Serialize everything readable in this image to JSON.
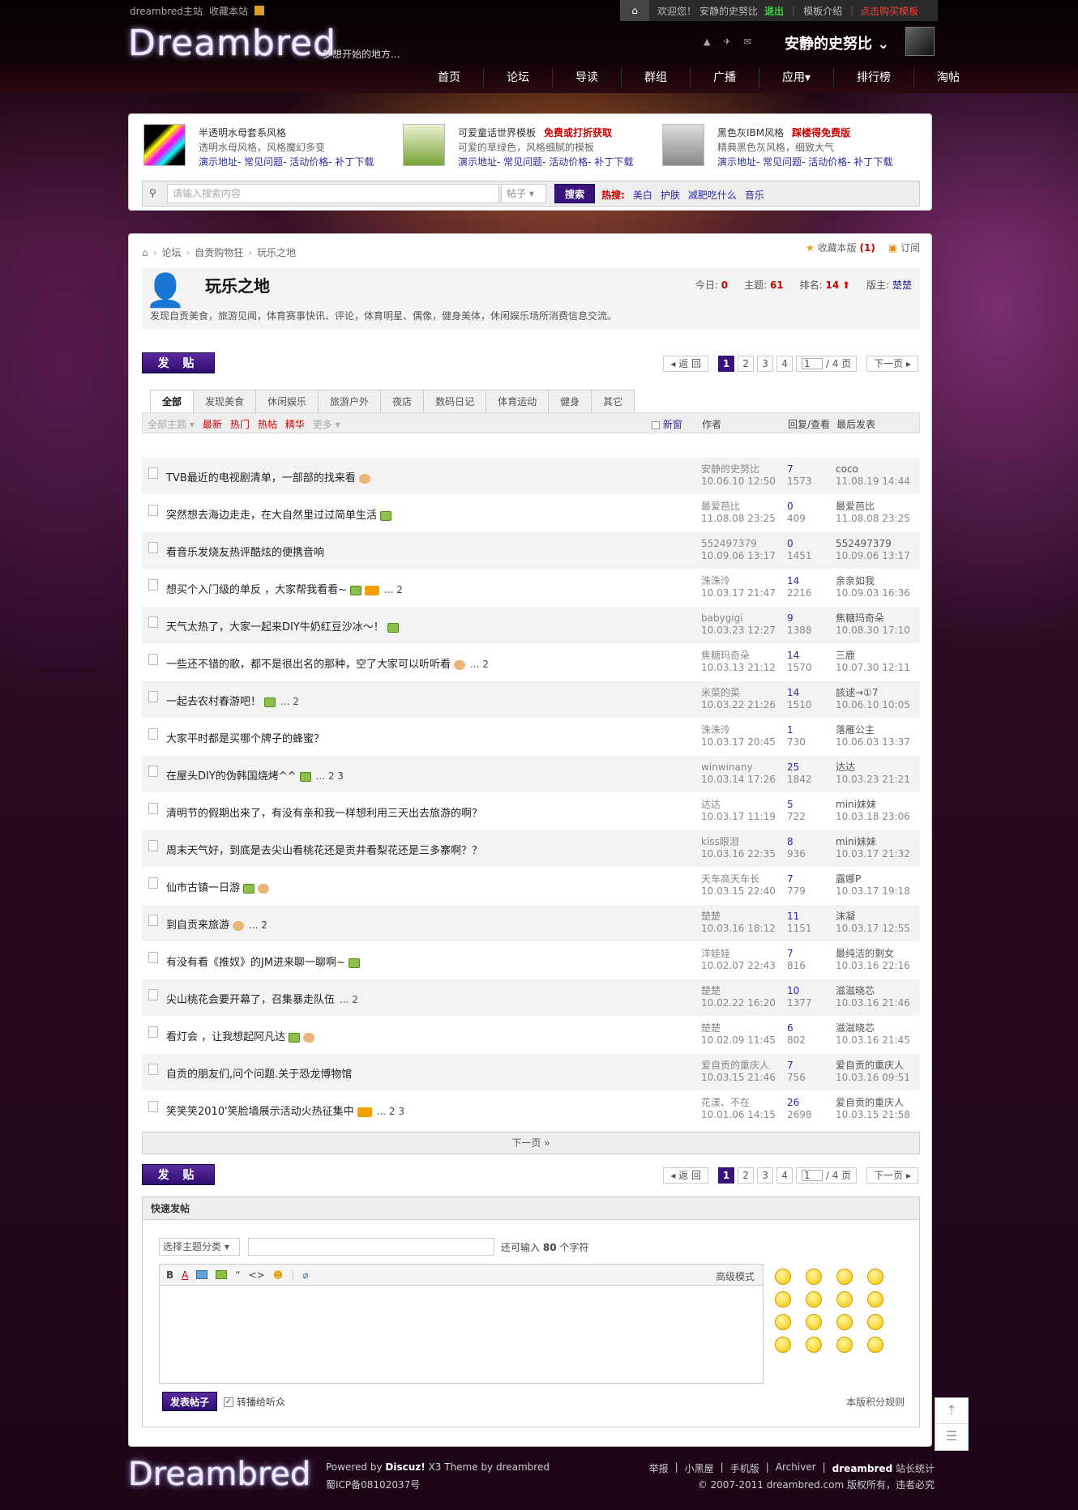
{
  "top": {
    "site_link": "dreambred主站",
    "fav_link": "收藏本站",
    "welcome": "欢迎您！",
    "user": "安静的史努比",
    "logout": "退出",
    "tpl_intro": "模板介绍",
    "buy": "点击购买模板"
  },
  "header": {
    "logo": "Dreambred",
    "slogan": "梦想开始的地方...",
    "username": "安静的史努比"
  },
  "nav": [
    "首页",
    "论坛",
    "导读",
    "群组",
    "广播",
    "应用▾",
    "排行榜",
    "淘帖"
  ],
  "promo": [
    {
      "t1": "半透明水母套系风格",
      "badge": "",
      "t2": "透明水母风格，风格魔幻多变",
      "t3": "演示地址- 常见问题- 活动价格- 补丁下载"
    },
    {
      "t1": "可爱童话世界模板",
      "badge": "免费或打折获取",
      "t2": "可爱的草绿色，风格细腻的模板",
      "t3": "演示地址- 常见问题- 活动价格- 补丁下载"
    },
    {
      "t1": "黑色灰IBM风格",
      "badge": "踩楼得免费版",
      "t2": "精典黑色灰风格，细致大气",
      "t3": "演示地址- 常见问题- 活动价格- 补丁下载"
    }
  ],
  "search": {
    "placeholder": "请输入搜索内容",
    "type": "帖子",
    "button": "搜索",
    "hot_label": "热搜:",
    "hot": [
      "美白",
      "护肤",
      "减肥吃什么",
      "音乐"
    ]
  },
  "breadcrumb": [
    "论坛",
    "自贡购物狂",
    "玩乐之地"
  ],
  "bc_right": {
    "fav": "收藏本版",
    "fav_count": "(1)",
    "sub": "订阅"
  },
  "forum": {
    "title": "玩乐之地",
    "today_label": "今日:",
    "today": "0",
    "topics_label": "主题:",
    "topics": "61",
    "rank_label": "排名:",
    "rank": "14",
    "mod_label": "版主:",
    "mod": "楚楚",
    "desc": "发现自贡美食，旅游见闻，体育赛事快讯、评论，体育明星、偶像，健身美体，休闲娱乐场所消费信息交流。"
  },
  "post_btn": "发 贴",
  "pager": {
    "back": "◂ 返 回",
    "pages": [
      "1",
      "2",
      "3",
      "4"
    ],
    "input": "1",
    "total": "/ 4 页",
    "next": "下一页 ▸"
  },
  "tabs": [
    "全部",
    "发现美食",
    "休闲娱乐",
    "旅游户外",
    "夜店",
    "数码日记",
    "体育运动",
    "健身",
    "其它"
  ],
  "filter": {
    "all": "全部主题 ▾",
    "newest": "最新",
    "hot": "热门",
    "hotpost": "热帖",
    "digest": "精华",
    "more": "更多 ▾",
    "new_label": "新窗",
    "author": "作者",
    "reply": "回复/查看",
    "last": "最后发表"
  },
  "threads": [
    {
      "title": "TVB最近的电视剧清单，一部部的找来看",
      "ex": [
        "thumb"
      ],
      "pages": "",
      "author": "安静的史努比",
      "adate": "10.06.10 12:50",
      "replies": "7",
      "views": "1573",
      "last": "coco",
      "ldate": "11.08.19 14:44"
    },
    {
      "title": "突然想去海边走走，在大自然里过过简单生活",
      "ex": [
        "img"
      ],
      "pages": "",
      "author": "最爱芭比",
      "adate": "11.08.08 23:25",
      "replies": "0",
      "views": "409",
      "last": "最爱芭比",
      "ldate": "11.08.08 23:25"
    },
    {
      "title": "看音乐发烧友热评酷炫的便携音响",
      "ex": [],
      "pages": "",
      "author": "552497379",
      "adate": "10.09.06 13:17",
      "replies": "0",
      "views": "1451",
      "last": "552497379",
      "ldate": "10.09.06 13:17"
    },
    {
      "title": "想买个入门级的单反 ，大家帮我看看~",
      "ex": [
        "img",
        "fire"
      ],
      "pages": "... 2",
      "author": "洙洙泠",
      "adate": "10.03.17 21:47",
      "replies": "14",
      "views": "2216",
      "last": "亲亲如我",
      "ldate": "10.09.03 16:36"
    },
    {
      "title": "天气太热了，大家一起来DIY牛奶红豆沙冰～！",
      "ex": [
        "img"
      ],
      "pages": "",
      "author": "babygigi",
      "adate": "10.03.23 12:27",
      "replies": "9",
      "views": "1388",
      "last": "焦糖玛奇朵",
      "ldate": "10.08.30 17:10"
    },
    {
      "title": "一些还不错的歌，都不是很出名的那种，空了大家可以听听看",
      "ex": [
        "thumb"
      ],
      "pages": "... 2",
      "author": "焦糖玛奇朵",
      "adate": "10.03.13 21:12",
      "replies": "14",
      "views": "1570",
      "last": "三鹿",
      "ldate": "10.07.30 12:11"
    },
    {
      "title": "一起去农村春游吧！",
      "ex": [
        "img"
      ],
      "pages": "... 2",
      "author": "米菜的菜",
      "adate": "10.03.22 21:26",
      "replies": "14",
      "views": "1510",
      "last": "該逑→①7",
      "ldate": "10.06.10 10:05"
    },
    {
      "title": "大家平时都是买哪个牌子的蜂蜜？",
      "ex": [],
      "pages": "",
      "author": "洙洙泠",
      "adate": "10.03.17 20:45",
      "replies": "1",
      "views": "730",
      "last": "落雁公主",
      "ldate": "10.06.03 13:37"
    },
    {
      "title": "在屋头DIY的伪韩国烧烤^^",
      "ex": [
        "img"
      ],
      "pages": "... 2 3",
      "author": "winwinany",
      "adate": "10.03.14 17:26",
      "replies": "25",
      "views": "1842",
      "last": "达达",
      "ldate": "10.03.23 21:21"
    },
    {
      "title": "清明节的假期出来了，有没有亲和我一样想利用三天出去旅游的啊？",
      "ex": [],
      "pages": "",
      "author": "达达",
      "adate": "10.03.17 11:19",
      "replies": "5",
      "views": "722",
      "last": "mini妹妹",
      "ldate": "10.03.18 23:06"
    },
    {
      "title": "周末天气好，到底是去尖山看桃花还是贡井看梨花还是三多寨啊？？",
      "ex": [],
      "pages": "",
      "author": "kiss眼泪",
      "adate": "10.03.16 22:35",
      "replies": "8",
      "views": "936",
      "last": "mini妹妹",
      "ldate": "10.03.17 21:32"
    },
    {
      "title": "仙市古镇一日游",
      "ex": [
        "img",
        "thumb"
      ],
      "pages": "",
      "author": "天车高天车长",
      "adate": "10.03.15 22:40",
      "replies": "7",
      "views": "779",
      "last": "露娜P",
      "ldate": "10.03.17 19:18"
    },
    {
      "title": "到自贡来旅游",
      "ex": [
        "thumb"
      ],
      "pages": "... 2",
      "author": "楚楚",
      "adate": "10.03.16 18:12",
      "replies": "11",
      "views": "1151",
      "last": "沫凝",
      "ldate": "10.03.17 12:55"
    },
    {
      "title": "有没有看《推奴》的JM进来聊一聊啊~",
      "ex": [
        "img"
      ],
      "pages": "",
      "author": "洋娃娃",
      "adate": "10.02.07 22:43",
      "replies": "7",
      "views": "816",
      "last": "最纯洁的剩女",
      "ldate": "10.03.16 22:16"
    },
    {
      "title": "尖山桃花会要开幕了，召集暴走队伍",
      "ex": [],
      "pages": "... 2",
      "author": "楚楚",
      "adate": "10.02.22 16:20",
      "replies": "10",
      "views": "1377",
      "last": "滋滋晓芯",
      "ldate": "10.03.16 21:46"
    },
    {
      "title": "看灯会 ，让我想起阿凡达",
      "ex": [
        "img",
        "thumb"
      ],
      "pages": "",
      "author": "楚楚",
      "adate": "10.02.09 11:45",
      "replies": "6",
      "views": "802",
      "last": "滋滋晓芯",
      "ldate": "10.03.16 21:45"
    },
    {
      "title": "自贡的朋友们,问个问题.关于恐龙博物馆",
      "ex": [],
      "pages": "",
      "author": "爱自贡的重庆人",
      "adate": "10.03.15 21:46",
      "replies": "7",
      "views": "756",
      "last": "爱自贡的重庆人",
      "ldate": "10.03.16 09:51"
    },
    {
      "title": "笑笑笑2010'笑脸墙展示活动火热征集中",
      "ex": [
        "fire"
      ],
      "pages": "... 2 3",
      "author": "花漾、不在",
      "adate": "10.01.06 14:15",
      "replies": "26",
      "views": "2698",
      "last": "爱自贡的重庆人",
      "ldate": "10.03.15 21:58"
    }
  ],
  "next_page": "下一页 »",
  "quick": {
    "title": "快速发帖",
    "select": "选择主题分类 ▾",
    "count_pre": "还可输入",
    "count": "80",
    "count_post": "个字符",
    "advanced": "高级模式",
    "post": "发表帖子",
    "forward": "转播给听众",
    "rule": "本版积分规则"
  },
  "footer": {
    "logo": "Dreambred",
    "powered": "Powered by",
    "discuz": "Discuz!",
    "ver": "X3  Theme by dreambred",
    "icp": "蜀ICP备08102037号",
    "links": [
      "举报",
      "|",
      "小黑屋",
      "|",
      "手机版",
      "|",
      "Archiver",
      "|"
    ],
    "stat_b": "dreambred",
    "stat": "站长统计",
    "copy": "© 2007-2011 dreambred.com 版权所有，违者必究"
  },
  "colors": {
    "accent": "#3a137a",
    "red": "#cc0000",
    "link": "#2a2aa0"
  }
}
